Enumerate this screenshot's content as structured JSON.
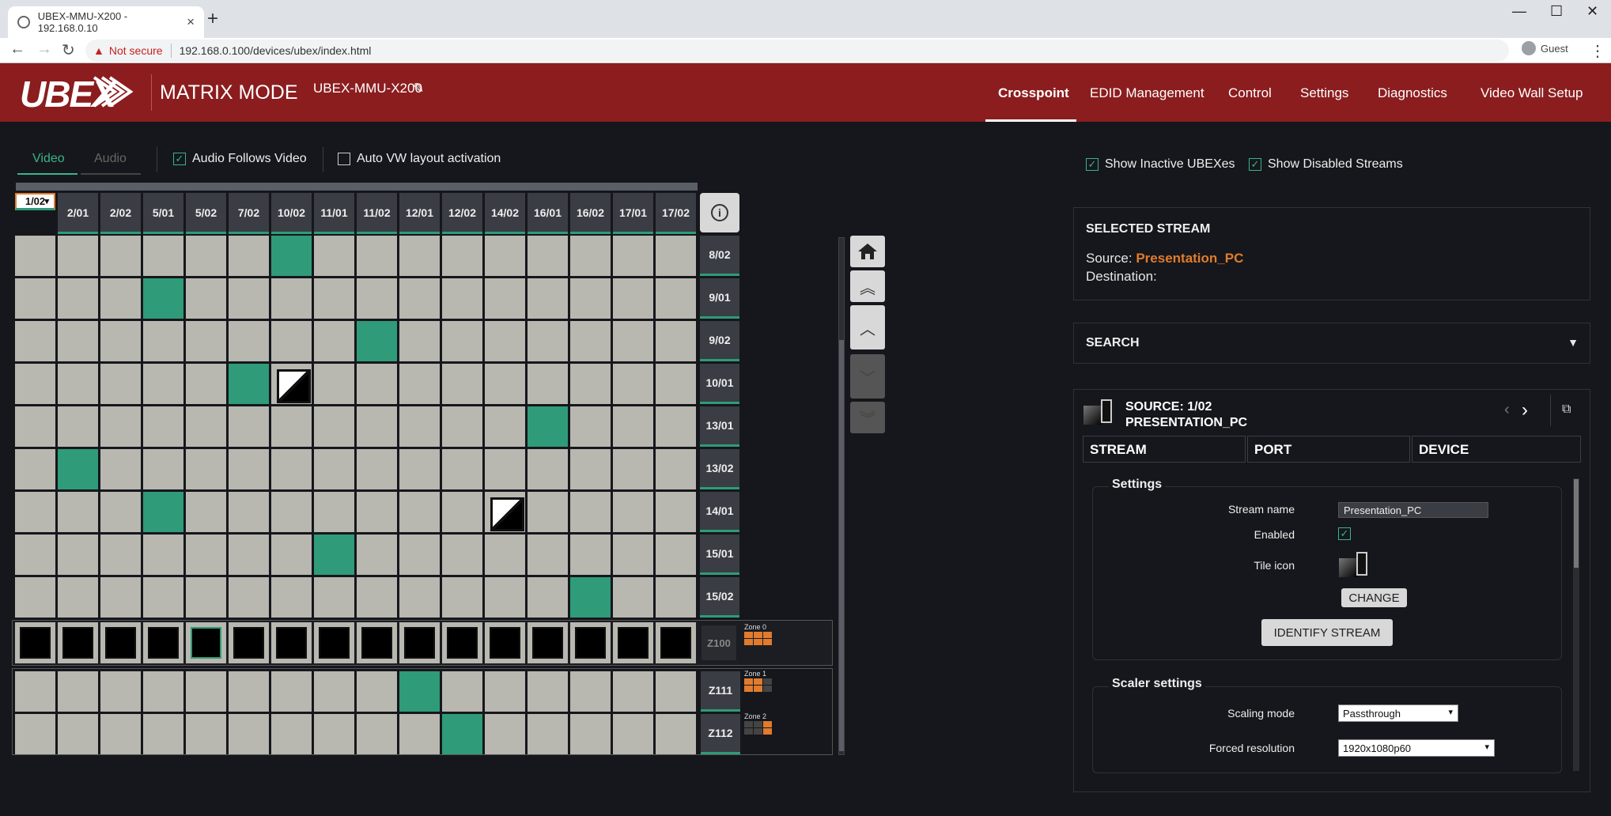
{
  "browser": {
    "tab_title": "UBEX-MMU-X200 - 192.168.0.10",
    "not_secure": "Not secure",
    "url": "192.168.0.100/devices/ubex/index.html",
    "guest": "Guest"
  },
  "app": {
    "logo": "UBEX",
    "mode": "MATRIX MODE",
    "device": "UBEX-MMU-X200",
    "nav": [
      "Crosspoint",
      "EDID Management",
      "Control",
      "Settings",
      "Diagnostics",
      "Video Wall Setup"
    ]
  },
  "left": {
    "tab_video": "Video",
    "tab_audio": "Audio",
    "audio_follows": "Audio Follows Video",
    "auto_vw": "Auto VW layout activation",
    "columns": [
      "1/02",
      "2/01",
      "2/02",
      "5/01",
      "5/02",
      "7/02",
      "10/02",
      "11/01",
      "11/02",
      "12/01",
      "12/02",
      "14/02",
      "16/01",
      "16/02",
      "17/01",
      "17/02"
    ],
    "rows": [
      "8/02",
      "9/01",
      "9/02",
      "10/01",
      "13/01",
      "13/02",
      "14/01",
      "15/01",
      "15/02"
    ],
    "vw_label": "Z100",
    "zone0": "Zone 0",
    "zone_rows": [
      "Z111",
      "Z112"
    ],
    "zone1": "Zone 1",
    "zone2": "Zone 2"
  },
  "right": {
    "show_inactive": "Show Inactive UBEXes",
    "show_disabled": "Show Disabled Streams",
    "selected_title": "SELECTED STREAM",
    "source_label": "Source:",
    "source_value": "Presentation_PC",
    "dest_label": "Destination:",
    "search": "SEARCH",
    "src_title": "SOURCE: 1/02",
    "src_name": "PRESENTATION_PC",
    "tabs": [
      "STREAM",
      "PORT",
      "DEVICE"
    ],
    "settings": "Settings",
    "stream_name_label": "Stream name",
    "stream_name": "Presentation_PC",
    "enabled": "Enabled",
    "tile_icon": "Tile icon",
    "change": "CHANGE",
    "identify": "IDENTIFY STREAM",
    "scaler": "Scaler settings",
    "scaling_mode_label": "Scaling mode",
    "scaling_mode": "Passthrough",
    "forced_res_label": "Forced resolution",
    "forced_res": "1920x1080p60"
  }
}
